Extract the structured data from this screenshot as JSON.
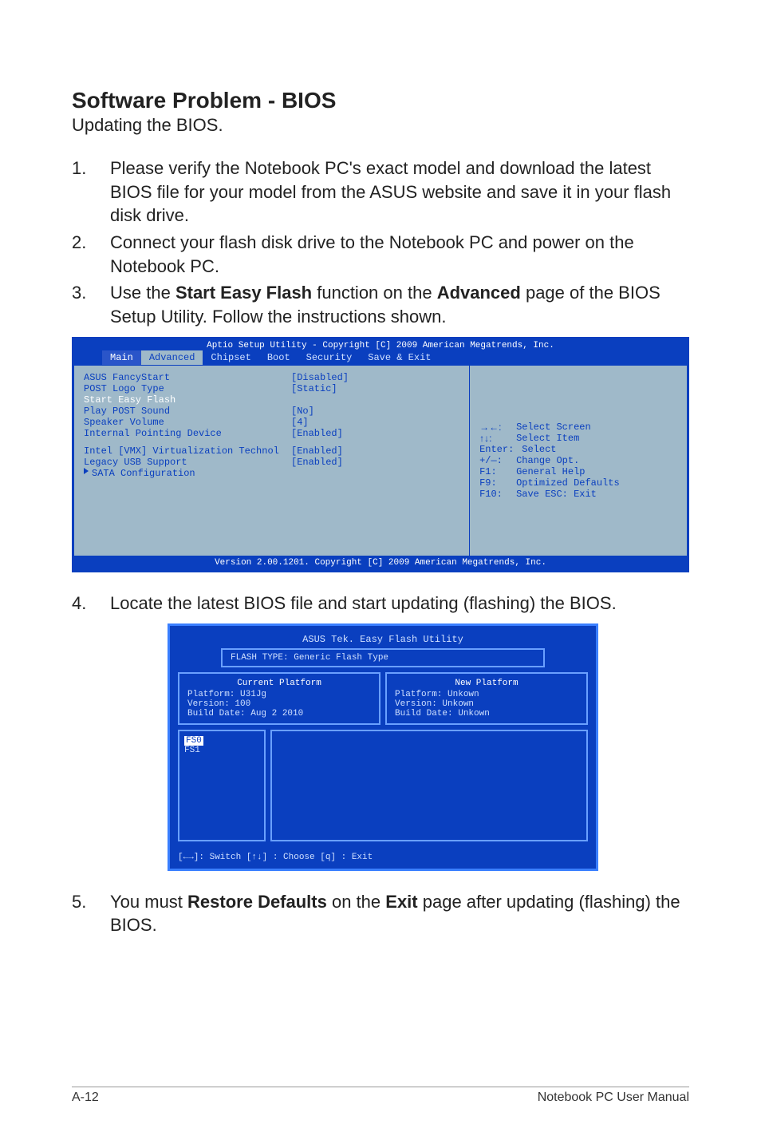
{
  "section": {
    "title": "Software Problem - BIOS",
    "subtitle": "Updating the BIOS."
  },
  "steps": {
    "s1": {
      "num": "1.",
      "text": "Please verify the Notebook PC's exact model and download the latest BIOS file for your model from the ASUS website and save it in your flash disk drive."
    },
    "s2": {
      "num": "2.",
      "text": "Connect your flash disk drive to the Notebook PC and power on the Notebook PC."
    },
    "s3": {
      "num": "3.",
      "pre": "Use the ",
      "b1": "Start Easy Flash",
      "mid": " function on the ",
      "b2": "Advanced",
      "post": " page of the BIOS Setup Utility. Follow the instructions shown."
    },
    "s4": {
      "num": "4.",
      "text": "Locate the latest BIOS file and start updating (flashing) the BIOS."
    },
    "s5": {
      "num": "5.",
      "pre": "You must ",
      "b1": "Restore Defaults",
      "mid": " on the ",
      "b2": "Exit",
      "post": " page after updating (flashing) the BIOS."
    }
  },
  "bios": {
    "topbar": "Aptio Setup Utility - Copyright [C] 2009 American Megatrends, Inc.",
    "tabs": {
      "main": "Main",
      "advanced": "Advanced",
      "chipset": "Chipset",
      "boot": "Boot",
      "security": "Security",
      "save": "Save & Exit"
    },
    "rows": {
      "r1": {
        "label": "ASUS FancyStart",
        "value": "[Disabled]"
      },
      "r2": {
        "label": "POST Logo Type",
        "value": "[Static]"
      },
      "r3": {
        "label": "Start Easy Flash",
        "value": ""
      },
      "r4": {
        "label": "Play POST Sound",
        "value": "[No]"
      },
      "r5": {
        "label": "Speaker Volume",
        "value": "[4]"
      },
      "r6": {
        "label": "Internal Pointing Device",
        "value": "[Enabled]"
      },
      "r7": {
        "label": "Intel  [VMX] Virtualization Technol",
        "value": "[Enabled]"
      },
      "r8": {
        "label": "Legacy USB Support",
        "value": "[Enabled]"
      },
      "r9": {
        "label": "SATA Configuration",
        "value": ""
      }
    },
    "hints": {
      "h1": {
        "key": "→←:",
        "text": "Select Screen"
      },
      "h2": {
        "key": "↑↓:",
        "text": "Select Item"
      },
      "h3": {
        "key": "Enter:",
        "text": "Select"
      },
      "h4": {
        "key": "+/—:",
        "text": "Change Opt."
      },
      "h5": {
        "key": "F1:",
        "text": "General Help"
      },
      "h6": {
        "key": "F9:",
        "text": "Optimized Defaults"
      },
      "h7": {
        "key": "F10:",
        "text": "Save    ESC: Exit"
      }
    },
    "bottombar": "Version 2.00.1201. Copyright [C] 2009 American Megatrends, Inc."
  },
  "flash": {
    "title": "ASUS Tek. Easy Flash Utility",
    "typebar": "FLASH TYPE: Generic Flash Type",
    "current": {
      "hdr": "Current Platform",
      "l1": "Platform:   U31Jg",
      "l2": "Version:     100",
      "l3": "Build Date: Aug 2 2010"
    },
    "newp": {
      "hdr": "New Platform",
      "l1": "Platform:   Unkown",
      "l2": "Version:    Unkown",
      "l3": "Build Date: Unkown"
    },
    "fs": {
      "sel": "FS0",
      "other": "FS1"
    },
    "footer": "[←→]: Switch   [↑↓] : Choose   [q] : Exit"
  },
  "footer": {
    "left": "A-12",
    "right": "Notebook PC User Manual"
  }
}
